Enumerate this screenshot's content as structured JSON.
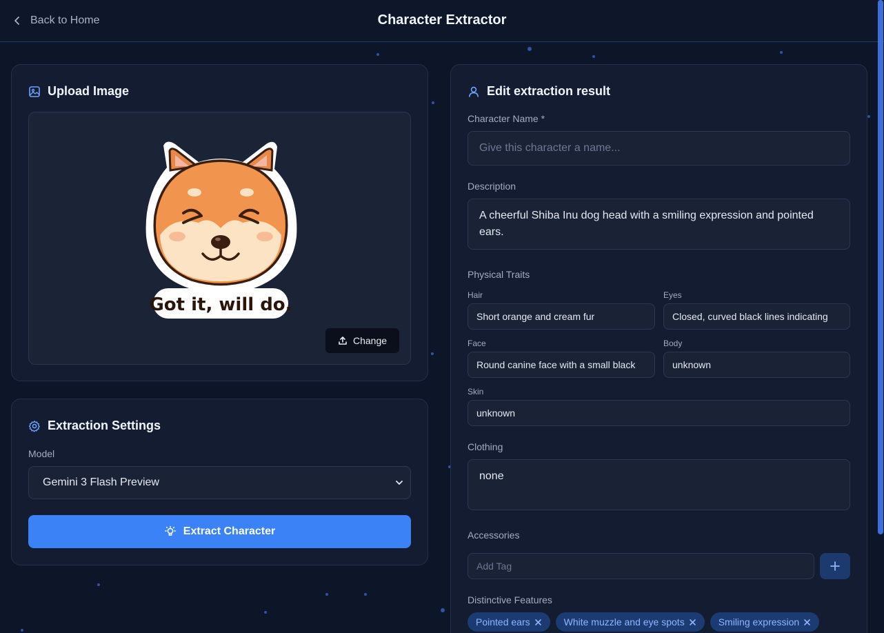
{
  "header": {
    "back_label": "Back to Home",
    "title": "Character Extractor"
  },
  "upload": {
    "title": "Upload Image",
    "sticker_caption": "Got it, will do.",
    "change_label": "Change"
  },
  "settings": {
    "title": "Extraction Settings",
    "model_label": "Model",
    "model_value": "Gemini 3 Flash Preview",
    "extract_label": "Extract Character"
  },
  "result": {
    "title": "Edit extraction result",
    "name_label": "Character Name *",
    "name_placeholder": "Give this character a name...",
    "description_label": "Description",
    "description_value": "A cheerful Shiba Inu dog head with a smiling expression and pointed ears.",
    "physical_traits_label": "Physical Traits",
    "traits": {
      "hair_label": "Hair",
      "hair_value": "Short orange and cream fur",
      "eyes_label": "Eyes",
      "eyes_value": "Closed, curved black lines indicating",
      "face_label": "Face",
      "face_value": "Round canine face with a small black",
      "body_label": "Body",
      "body_value": "unknown",
      "skin_label": "Skin",
      "skin_value": "unknown"
    },
    "clothing_label": "Clothing",
    "clothing_value": "none",
    "accessories_label": "Accessories",
    "accessories_placeholder": "Add Tag",
    "distinctive_label": "Distinctive Features",
    "distinctive_tags": [
      "Pointed ears",
      "White muzzle and eye spots",
      "Smiling expression"
    ]
  },
  "colors": {
    "accent": "#3b82f6",
    "background": "#0d1528",
    "card": "#131c30",
    "tag_bg": "#1d3b73",
    "tag_text": "#8fb5ff"
  },
  "icons": {
    "back": "chevron-left-icon",
    "upload": "image-icon",
    "change": "upload-icon",
    "settings": "gear-icon",
    "extract": "lightbulb-icon",
    "result": "user-icon",
    "add": "plus-icon",
    "tag_remove": "close-icon"
  }
}
